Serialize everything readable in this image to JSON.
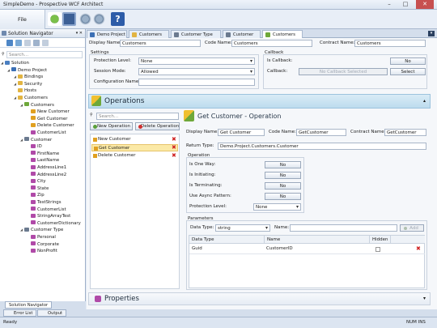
{
  "window": {
    "title": "SimpleDemo - Prospective WCF Architect",
    "minimize": "–",
    "maximize": "□",
    "close": "✕"
  },
  "ribbon": {
    "file_label": "File"
  },
  "navigator": {
    "title": "Solution Navigator",
    "search_placeholder": "Search...",
    "pin": "▾ ✕",
    "tree": [
      {
        "label": "Solution",
        "level": 0,
        "icon": "solution-icon",
        "color": "#4a7fc1"
      },
      {
        "label": "Demo Project",
        "level": 1,
        "icon": "project-icon",
        "color": "#3b6fb4"
      },
      {
        "label": "Bindings",
        "level": 2,
        "icon": "folder-icon",
        "color": "#e2b441"
      },
      {
        "label": "Security",
        "level": 2,
        "icon": "folder-icon",
        "color": "#e2b441"
      },
      {
        "label": "Hosts",
        "level": 2,
        "icon": "folder-icon",
        "color": "#e2b441"
      },
      {
        "label": "Customers",
        "level": 2,
        "icon": "folder-icon",
        "color": "#e2b441"
      },
      {
        "label": "Customers",
        "level": 3,
        "icon": "service-icon",
        "color": "#6ea83a"
      },
      {
        "label": "New Customer",
        "level": 4,
        "icon": "operation-icon",
        "color": "#e0a020"
      },
      {
        "label": "Get Customer",
        "level": 4,
        "icon": "operation-icon",
        "color": "#e0a020"
      },
      {
        "label": "Delete Customer",
        "level": 4,
        "icon": "operation-icon",
        "color": "#e0a020"
      },
      {
        "label": "CustomerList",
        "level": 4,
        "icon": "data-icon",
        "color": "#b04aa8"
      },
      {
        "label": "Customer",
        "level": 3,
        "icon": "datatype-icon",
        "color": "#6b7a8f"
      },
      {
        "label": "ID",
        "level": 4,
        "icon": "member-icon",
        "color": "#b04aa8"
      },
      {
        "label": "FirstName",
        "level": 4,
        "icon": "member-icon",
        "color": "#b04aa8"
      },
      {
        "label": "LastName",
        "level": 4,
        "icon": "member-icon",
        "color": "#b04aa8"
      },
      {
        "label": "AddressLine1",
        "level": 4,
        "icon": "member-icon",
        "color": "#b04aa8"
      },
      {
        "label": "AddressLine2",
        "level": 4,
        "icon": "member-icon",
        "color": "#b04aa8"
      },
      {
        "label": "City",
        "level": 4,
        "icon": "member-icon",
        "color": "#b04aa8"
      },
      {
        "label": "State",
        "level": 4,
        "icon": "member-icon",
        "color": "#b04aa8"
      },
      {
        "label": "Zip",
        "level": 4,
        "icon": "member-icon",
        "color": "#b04aa8"
      },
      {
        "label": "TestStrings",
        "level": 4,
        "icon": "member-icon",
        "color": "#b04aa8"
      },
      {
        "label": "CustomerList",
        "level": 4,
        "icon": "member-icon",
        "color": "#b04aa8"
      },
      {
        "label": "StringArrayTest",
        "level": 4,
        "icon": "member-icon",
        "color": "#b04aa8"
      },
      {
        "label": "CustomerDictionary",
        "level": 4,
        "icon": "member-icon",
        "color": "#b04aa8"
      },
      {
        "label": "Customer Type",
        "level": 3,
        "icon": "enum-icon",
        "color": "#6b7a8f"
      },
      {
        "label": "Personal",
        "level": 4,
        "icon": "member-icon",
        "color": "#b04aa8"
      },
      {
        "label": "Corporate",
        "level": 4,
        "icon": "member-icon",
        "color": "#b04aa8"
      },
      {
        "label": "NonProfit",
        "level": 4,
        "icon": "member-icon",
        "color": "#b04aa8"
      }
    ],
    "bottom_tab": "Solution Navigator"
  },
  "dock_tabs": [
    "Error List",
    "Output"
  ],
  "doc_tabs": [
    "Demo Project",
    "Customers",
    "Customer Type",
    "Customer",
    "Customers"
  ],
  "service": {
    "display_name_label": "Display Name:",
    "display_name": "Customers",
    "code_name_label": "Code Name:",
    "code_name": "Customers",
    "contract_name_label": "Contract Name:",
    "contract_name": "Customers",
    "settings_title": "Settings",
    "protection_label": "Protection Level:",
    "protection": "None",
    "session_label": "Session Mode:",
    "session": "Allowed",
    "config_label": "Configuration Name:",
    "config": "",
    "callback_title": "Callback",
    "is_callback_label": "Is Callback:",
    "is_callback": "No",
    "callback_label": "Callback:",
    "callback": "No Callback Selected",
    "select_label": "Select"
  },
  "operations": {
    "title": "Operations",
    "search_placeholder": "Search...",
    "new_btn": "New Operation",
    "delete_btn": "Delete Operation",
    "items": [
      "New Customer",
      "Get Customer",
      "Delete Customer"
    ],
    "selected": "Get Customer",
    "detail_title": "Get Customer - Operation",
    "display_name_label": "Display Name:",
    "display_name": "Get Customer",
    "code_name_label": "Code Name:",
    "code_name": "GetCustomer",
    "contract_name_label": "Contract Name:",
    "contract_name": "GetCustomer",
    "return_type_label": "Return Type:",
    "return_type": "Demo.Project.Customers.Customer",
    "operation_group": "Operation",
    "flags": [
      {
        "label": "Is One Way:",
        "value": "No"
      },
      {
        "label": "Is Initiating:",
        "value": "No"
      },
      {
        "label": "Is Terminating:",
        "value": "No"
      },
      {
        "label": "Use Async Pattern:",
        "value": "No"
      }
    ],
    "protection_label": "Protection Level:",
    "protection": "None",
    "parameters_group": "Parameters",
    "data_type_label": "Data Type:",
    "data_type": "string",
    "name_label": "Name:",
    "name": "",
    "add_btn": "Add",
    "columns": [
      "Data Type",
      "Name",
      "Hidden"
    ],
    "rows": [
      {
        "data_type": "Guid",
        "name": "CustomerID"
      }
    ]
  },
  "properties": {
    "title": "Properties"
  },
  "status": {
    "left": "Ready",
    "right": "NUM  INS"
  }
}
